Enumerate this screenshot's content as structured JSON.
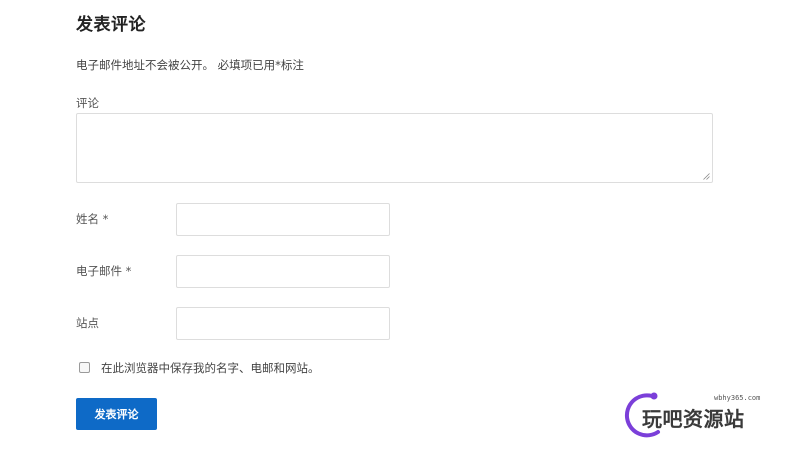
{
  "form": {
    "title": "发表评论",
    "notes": "电子邮件地址不会被公开。 必填项已用*标注",
    "comment_label": "评论",
    "fields": [
      {
        "label": "姓名 *"
      },
      {
        "label": "电子邮件 *"
      },
      {
        "label": "站点"
      }
    ],
    "save_info_label": "在此浏览器中保存我的名字、电邮和网站。",
    "save_info_checked": false,
    "submit_label": "发表评论"
  },
  "watermark": {
    "domain": "wbhy365.com",
    "text": "玩吧资源站"
  },
  "colors": {
    "accent": "#0e6ac7",
    "watermark_ring": "#7b3fd9"
  }
}
